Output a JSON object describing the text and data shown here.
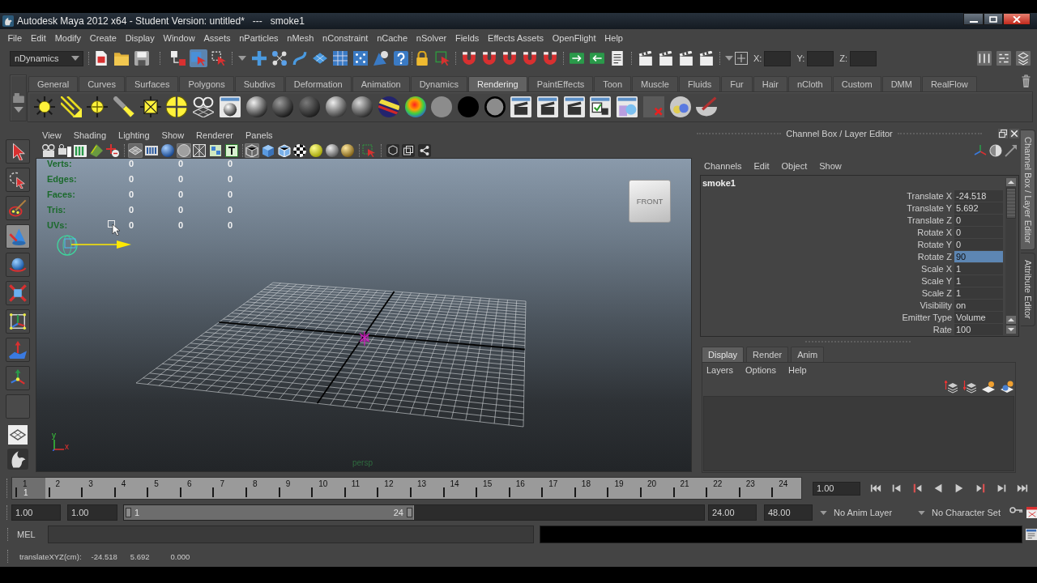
{
  "window": {
    "title": "Autodesk Maya 2012 x64 - Student Version: untitled*   ---   smoke1"
  },
  "menu_bar": [
    "File",
    "Edit",
    "Modify",
    "Create",
    "Display",
    "Window",
    "Assets",
    "nParticles",
    "nMesh",
    "nConstraint",
    "nCache",
    "nSolver",
    "Fields",
    "Effects Assets",
    "OpenFlight",
    "Help"
  ],
  "status_line": {
    "menu_set": "nDynamics",
    "selection_modes": [
      {
        "selected": false
      },
      {
        "selected": true
      },
      {
        "selected": false
      }
    ],
    "coordinates": [
      {
        "label": "X:"
      },
      {
        "label": "Y:"
      },
      {
        "label": "Z:"
      }
    ]
  },
  "shelf": {
    "tabs": [
      {
        "label": "General",
        "selected": false
      },
      {
        "label": "Curves",
        "selected": false
      },
      {
        "label": "Surfaces",
        "selected": false
      },
      {
        "label": "Polygons",
        "selected": false
      },
      {
        "label": "Subdivs",
        "selected": false
      },
      {
        "label": "Deformation",
        "selected": false
      },
      {
        "label": "Animation",
        "selected": false
      },
      {
        "label": "Dynamics",
        "selected": false
      },
      {
        "label": "Rendering",
        "selected": true
      },
      {
        "label": "PaintEffects",
        "selected": false
      },
      {
        "label": "Toon",
        "selected": false
      },
      {
        "label": "Muscle",
        "selected": false
      },
      {
        "label": "Fluids",
        "selected": false
      },
      {
        "label": "Fur",
        "selected": false
      },
      {
        "label": "Hair",
        "selected": false
      },
      {
        "label": "nCloth",
        "selected": false
      },
      {
        "label": "Custom",
        "selected": false
      },
      {
        "label": "DMM",
        "selected": false
      },
      {
        "label": "RealFlow",
        "selected": false
      }
    ]
  },
  "tool_box": {
    "tools": [
      {
        "selected": false
      },
      {
        "selected": false
      },
      {
        "selected": false
      },
      {
        "selected": true
      },
      {
        "selected": false
      },
      {
        "selected": false
      },
      {
        "selected": false
      },
      {
        "selected": false
      },
      {
        "selected": false
      }
    ]
  },
  "panel": {
    "menus": [
      "View",
      "Shading",
      "Lighting",
      "Show",
      "Renderer",
      "Panels"
    ],
    "toolbar": [
      {
        "on": false
      },
      {
        "on": false
      },
      {
        "on": false
      },
      {
        "on": false
      },
      {
        "on": false
      },
      {
        "on": true
      },
      {
        "on": false
      },
      {
        "on": false
      },
      {
        "on": true
      },
      {
        "on": false
      },
      {
        "on": false
      },
      {
        "on": false
      },
      {
        "on": true
      },
      {
        "on": false
      },
      {
        "on": false
      },
      {
        "on": false
      },
      {
        "on": false
      },
      {
        "on": false
      },
      {
        "on": false
      },
      {
        "on": false
      },
      {
        "on": false
      },
      {
        "on": false
      },
      {
        "on": false
      }
    ],
    "hud": [
      {
        "label": "Verts:",
        "values": [
          "0",
          "0",
          "0"
        ]
      },
      {
        "label": "Edges:",
        "values": [
          "0",
          "0",
          "0"
        ]
      },
      {
        "label": "Faces:",
        "values": [
          "0",
          "0",
          "0"
        ]
      },
      {
        "label": "Tris:",
        "values": [
          "0",
          "0",
          "0"
        ]
      },
      {
        "label": "UVs:",
        "values": [
          "0",
          "0",
          "0"
        ]
      }
    ],
    "view_cube": {
      "label": "FRONT"
    },
    "axis_labels": [
      "y",
      "x"
    ],
    "camera": "persp"
  },
  "channel_box": {
    "title": "Channel Box / Layer Editor",
    "menus": [
      "Channels",
      "Edit",
      "Object",
      "Show"
    ],
    "object": "smoke1",
    "channels": [
      {
        "name": "Translate X",
        "value": "-24.518",
        "selected": false
      },
      {
        "name": "Translate Y",
        "value": "5.692",
        "selected": false
      },
      {
        "name": "Translate Z",
        "value": "0",
        "selected": false
      },
      {
        "name": "Rotate X",
        "value": "0",
        "selected": false
      },
      {
        "name": "Rotate Y",
        "value": "0",
        "selected": false
      },
      {
        "name": "Rotate Z",
        "value": "90",
        "selected": true
      },
      {
        "name": "Scale X",
        "value": "1",
        "selected": false
      },
      {
        "name": "Scale Y",
        "value": "1",
        "selected": false
      },
      {
        "name": "Scale Z",
        "value": "1",
        "selected": false
      },
      {
        "name": "Visibility",
        "value": "on",
        "selected": false
      },
      {
        "name": "Emitter Type",
        "value": "Volume",
        "selected": false
      },
      {
        "name": "Rate",
        "value": "100",
        "selected": false
      }
    ]
  },
  "layer_editor": {
    "tabs": [
      {
        "label": "Display",
        "selected": true
      },
      {
        "label": "Render",
        "selected": false
      },
      {
        "label": "Anim",
        "selected": false
      }
    ],
    "menus": [
      "Layers",
      "Options",
      "Help"
    ]
  },
  "side_tabs": [
    {
      "label": "Channel Box / Layer Editor",
      "selected": true
    },
    {
      "label": "Attribute Editor",
      "selected": false
    }
  ],
  "time_slider": {
    "frames": [
      "1",
      "2",
      "3",
      "4",
      "5",
      "6",
      "7",
      "8",
      "9",
      "10",
      "11",
      "12",
      "13",
      "14",
      "15",
      "16",
      "17",
      "18",
      "19",
      "20",
      "21",
      "22",
      "23",
      "24"
    ],
    "current_frame": "1",
    "level": 0,
    "current_time": "1.00"
  },
  "range_slider": {
    "start_time": "1.00",
    "playback_start": "1.00",
    "range_start": "1",
    "range_end": "24",
    "level": 0.5,
    "playback_end": "24.00",
    "end_time": "48.00",
    "anim_layer": "No Anim Layer",
    "character_set": "No Character Set"
  },
  "command_line": {
    "language": "MEL"
  },
  "help_line": {
    "label": "translateXYZ(cm):",
    "values": [
      "-24.518",
      "5.692",
      "0.000"
    ]
  }
}
